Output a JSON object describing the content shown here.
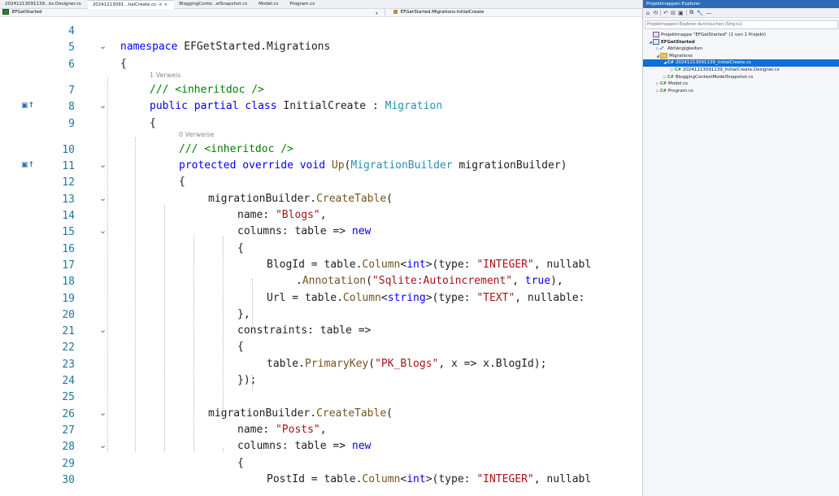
{
  "tabs": [
    {
      "label": "20241213091139...ks.Designer.cs",
      "active": false
    },
    {
      "label": "20241213091...tialCreate.cs",
      "active": true,
      "pin": "⊕",
      "close": "×"
    },
    {
      "label": "BloggingConte...elSnapshot.cs",
      "active": false
    },
    {
      "label": "Model.cs",
      "active": false
    },
    {
      "label": "Program.cs",
      "active": false
    }
  ],
  "navbar": {
    "project": "EFGetStarted",
    "member": "EFGetStarted.Migrations.InitialCreate"
  },
  "code": {
    "lines": [
      {
        "n": "4",
        "fold": "",
        "margin": "",
        "indent": 0,
        "text": ""
      },
      {
        "n": "5",
        "fold": "⌄",
        "margin": "",
        "indent": 0,
        "text": "namespace EFGetStarted.Migrations"
      },
      {
        "n": "6",
        "fold": "",
        "margin": "",
        "indent": 0,
        "text": "{"
      },
      {
        "n": "7",
        "fold": "",
        "margin": "",
        "indent": 1,
        "text": "/// <inheritdoc />",
        "hint": "1 Verweis"
      },
      {
        "n": "8",
        "fold": "⌄",
        "margin": "▣↑",
        "indent": 1,
        "text": "public partial class InitialCreate : Migration"
      },
      {
        "n": "9",
        "fold": "",
        "margin": "",
        "indent": 1,
        "text": "{"
      },
      {
        "n": "10",
        "fold": "",
        "margin": "",
        "indent": 2,
        "text": "/// <inheritdoc />",
        "hint": "0 Verweise"
      },
      {
        "n": "11",
        "fold": "⌄",
        "margin": "▣↑",
        "indent": 2,
        "text": "protected override void Up(MigrationBuilder migrationBuilder)"
      },
      {
        "n": "12",
        "fold": "",
        "margin": "",
        "indent": 2,
        "text": "{"
      },
      {
        "n": "13",
        "fold": "⌄",
        "margin": "",
        "indent": 3,
        "text": "migrationBuilder.CreateTable("
      },
      {
        "n": "14",
        "fold": "",
        "margin": "",
        "indent": 4,
        "text": "name: \"Blogs\","
      },
      {
        "n": "15",
        "fold": "⌄",
        "margin": "",
        "indent": 4,
        "text": "columns: table => new"
      },
      {
        "n": "16",
        "fold": "",
        "margin": "",
        "indent": 4,
        "text": "{"
      },
      {
        "n": "17",
        "fold": "",
        "margin": "",
        "indent": 5,
        "text": "BlogId = table.Column<int>(type: \"INTEGER\", nullabl"
      },
      {
        "n": "18",
        "fold": "",
        "margin": "",
        "indent": 6,
        "text": ".Annotation(\"Sqlite:Autoincrement\", true),"
      },
      {
        "n": "19",
        "fold": "",
        "margin": "",
        "indent": 5,
        "text": "Url = table.Column<string>(type: \"TEXT\", nullable: "
      },
      {
        "n": "20",
        "fold": "",
        "margin": "",
        "indent": 4,
        "text": "},"
      },
      {
        "n": "21",
        "fold": "⌄",
        "margin": "",
        "indent": 4,
        "text": "constraints: table =>"
      },
      {
        "n": "22",
        "fold": "",
        "margin": "",
        "indent": 4,
        "text": "{"
      },
      {
        "n": "23",
        "fold": "",
        "margin": "",
        "indent": 5,
        "text": "table.PrimaryKey(\"PK_Blogs\", x => x.BlogId);"
      },
      {
        "n": "24",
        "fold": "",
        "margin": "",
        "indent": 4,
        "text": "});"
      },
      {
        "n": "25",
        "fold": "",
        "margin": "",
        "indent": 0,
        "text": ""
      },
      {
        "n": "26",
        "fold": "⌄",
        "margin": "",
        "indent": 3,
        "text": "migrationBuilder.CreateTable("
      },
      {
        "n": "27",
        "fold": "",
        "margin": "",
        "indent": 4,
        "text": "name: \"Posts\","
      },
      {
        "n": "28",
        "fold": "⌄",
        "margin": "",
        "indent": 4,
        "text": "columns: table => new"
      },
      {
        "n": "29",
        "fold": "",
        "margin": "",
        "indent": 4,
        "text": "{"
      },
      {
        "n": "30",
        "fold": "",
        "margin": "",
        "indent": 5,
        "text": "PostId = table.Column<int>(type: \"INTEGER\", nullabl"
      }
    ]
  },
  "solution_explorer": {
    "title": "Projektmappen-Explorer",
    "search_placeholder": "Projektmappen-Explorer durchsuchen (Strg+ü)",
    "toolbar_icons": [
      "home-icon",
      "sync-icon",
      "back-icon",
      "collapse-icon",
      "show-all-icon",
      "preview-icon",
      "properties-icon",
      "pin-icon"
    ],
    "nodes": [
      {
        "label": "Projektmappe \"EFGetStarted\" (1 von 1 Projekt)",
        "arrow": "",
        "icon": "solution",
        "icon_text": "",
        "level": 0,
        "selected": false
      },
      {
        "label": "EFGetStarted",
        "arrow": "◢",
        "icon": "project",
        "icon_text": "",
        "level": 0,
        "selected": false,
        "bold": true
      },
      {
        "label": "Abhängigkeiten",
        "arrow": "▷",
        "icon": "deps",
        "icon_text": "₈⁰",
        "level": 1,
        "selected": false
      },
      {
        "label": "Migrations",
        "arrow": "◢",
        "icon": "folder",
        "icon_text": "",
        "level": 1,
        "selected": false
      },
      {
        "label": "20241213091139_InitialCreate.cs",
        "arrow": "◢",
        "icon": "cs",
        "icon_text": "C#",
        "level": 2,
        "selected": true
      },
      {
        "label": "20241213091139_InitialCreate.Designer.cs",
        "arrow": "▷",
        "icon": "cs",
        "icon_text": "C#",
        "level": 3,
        "selected": false
      },
      {
        "label": "BloggingContextModelSnapshot.cs",
        "arrow": "▷",
        "icon": "cs",
        "icon_text": "C#",
        "level": 2,
        "selected": false
      },
      {
        "label": "Model.cs",
        "arrow": "▷",
        "icon": "cs",
        "icon_text": "C#",
        "level": 1,
        "selected": false
      },
      {
        "label": "Program.cs",
        "arrow": "▷",
        "icon": "cs",
        "icon_text": "C#",
        "level": 1,
        "selected": false
      }
    ]
  },
  "colors": {
    "keyword": "#0000ff",
    "type": "#2b91af",
    "method": "#74531f",
    "string": "#a31515",
    "comment": "#008000",
    "line_number": "#237893",
    "selection": "#0e6fd6",
    "panel_title": "#2f6cb8"
  }
}
